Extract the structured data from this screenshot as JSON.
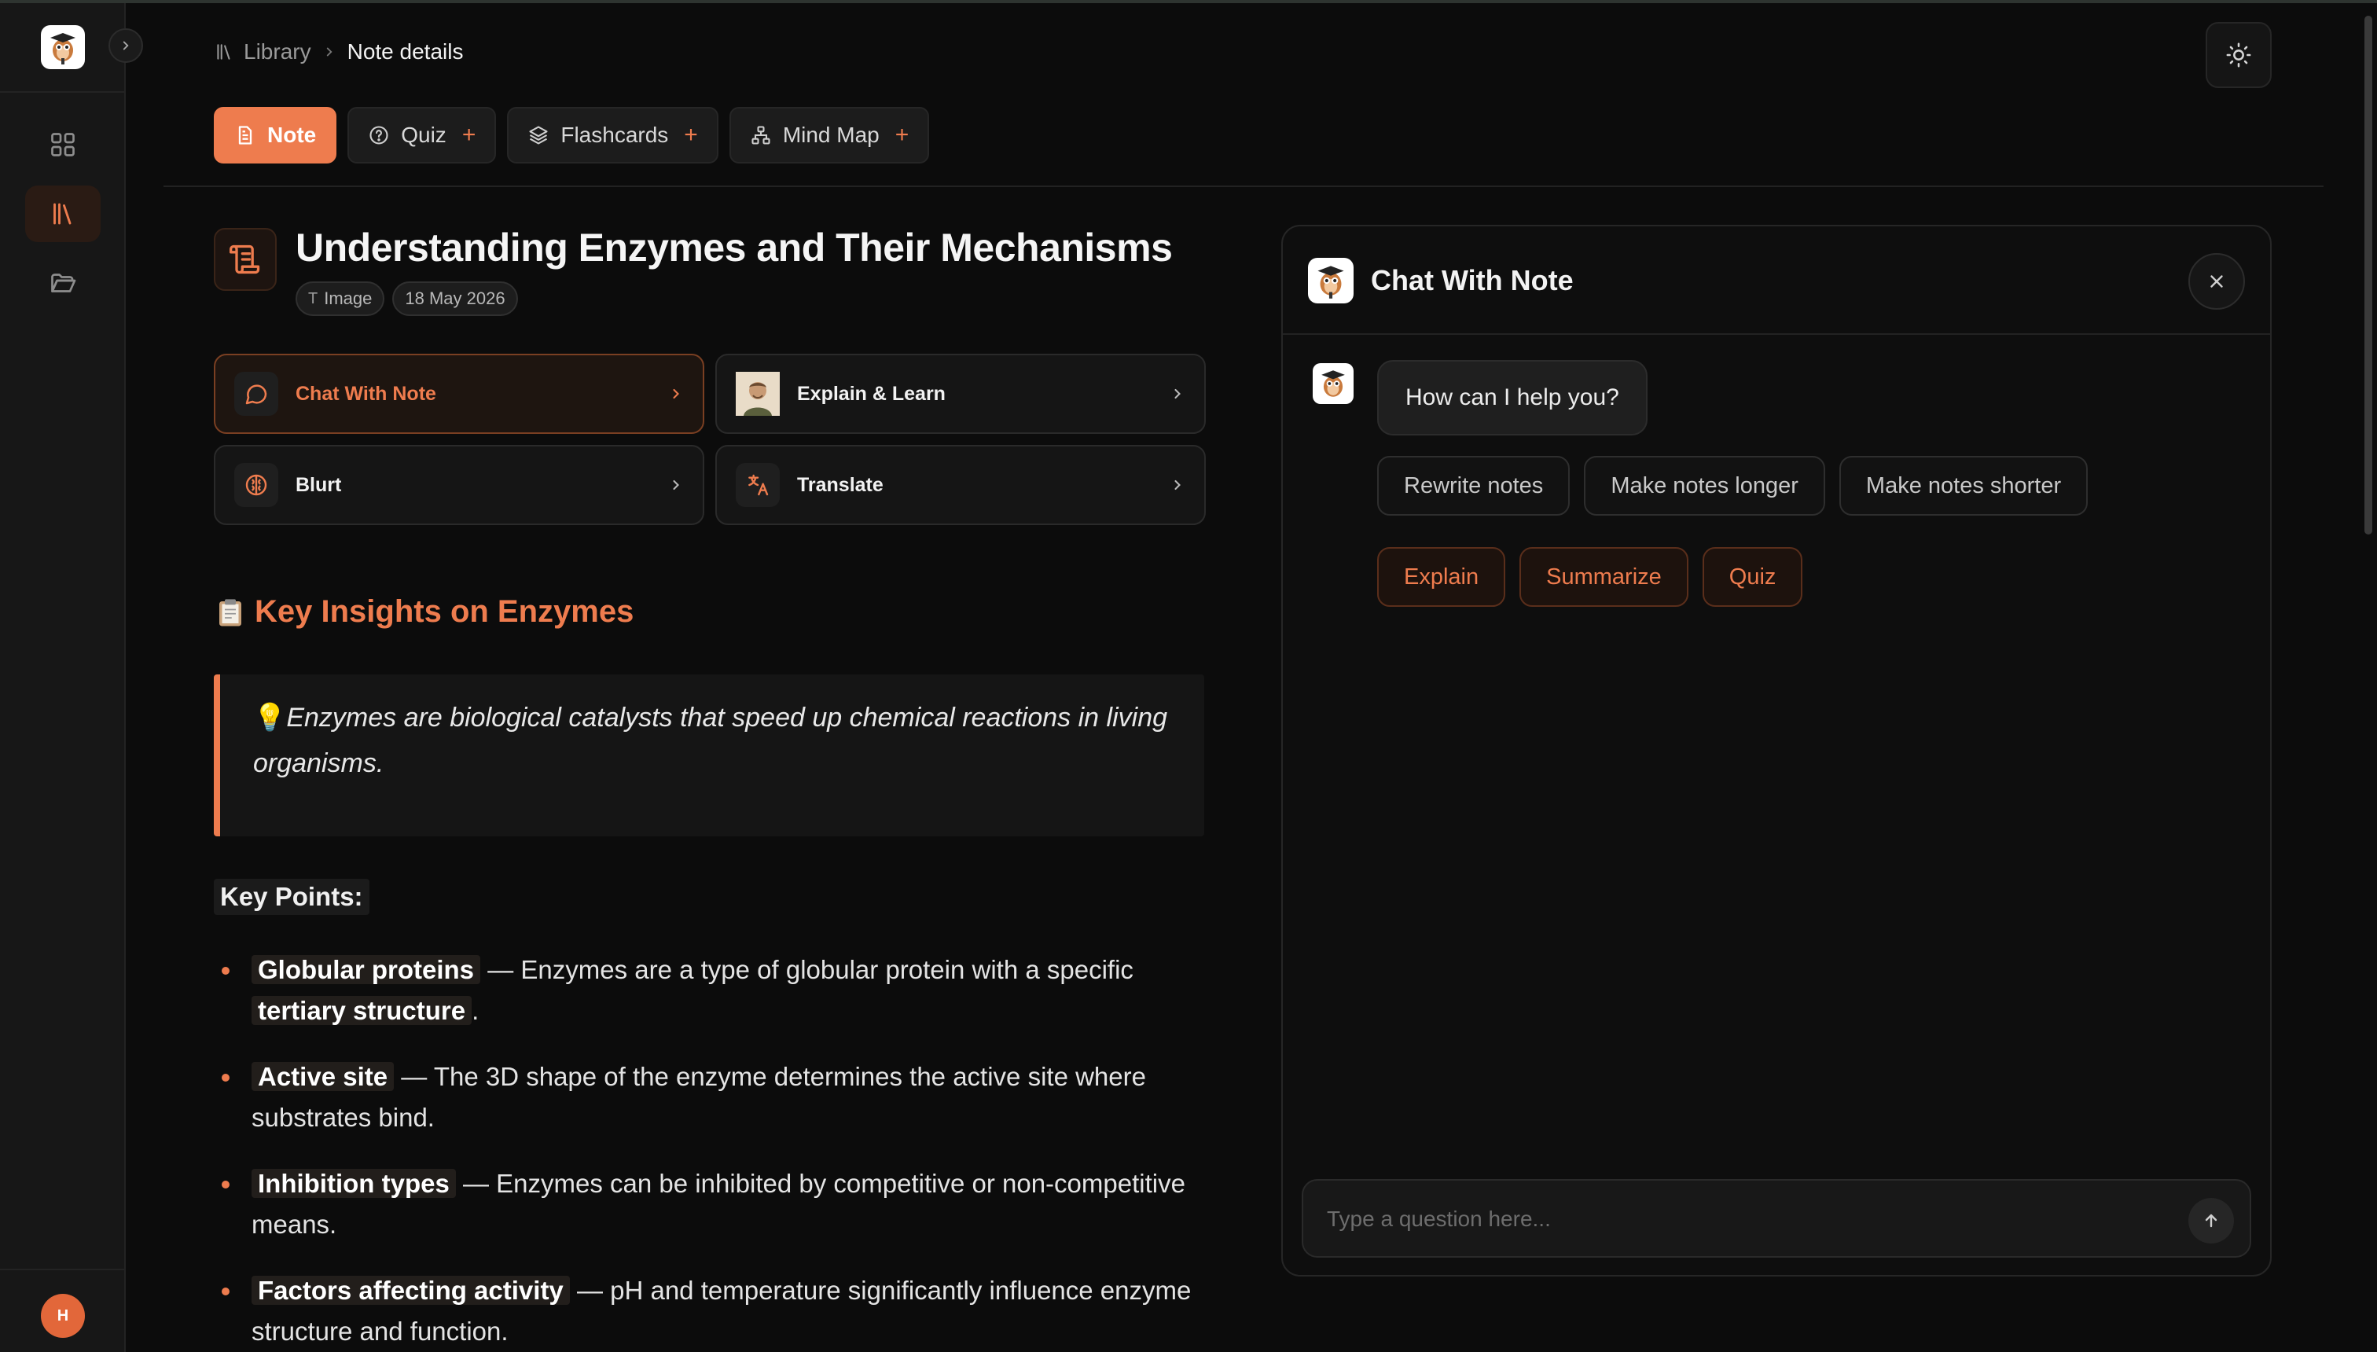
{
  "breadcrumb": {
    "library": "Library",
    "current": "Note details"
  },
  "tabs": [
    {
      "label": "Note",
      "active": true,
      "icon": "document-icon"
    },
    {
      "label": "Quiz",
      "active": false,
      "icon": "help-circle-icon"
    },
    {
      "label": "Flashcards",
      "active": false,
      "icon": "layers-icon"
    },
    {
      "label": "Mind Map",
      "active": false,
      "icon": "sitemap-icon"
    }
  ],
  "note": {
    "title": "Understanding Enzymes and Their Mechanisms",
    "type_chip": "Image",
    "date_chip": "18 May 2026"
  },
  "actions": {
    "chat": "Chat With Note",
    "explain": "Explain & Learn",
    "blurt": "Blurt",
    "translate": "Translate"
  },
  "content": {
    "section_heading": "Key Insights on Enzymes",
    "quote": "Enzymes are biological catalysts that speed up chemical reactions in living organisms.",
    "key_points_label": "Key Points:",
    "bullets": [
      {
        "term": "Globular proteins",
        "text1": " — Enzymes are a type of globular protein with a specific ",
        "term2": "tertiary structure",
        "text2": "."
      },
      {
        "term": "Active site",
        "text1": " — The 3D shape of the enzyme determines the active site where substrates bind."
      },
      {
        "term": "Inhibition types",
        "text1": " — Enzymes can be inhibited by competitive or non-competitive means."
      },
      {
        "term": "Factors affecting activity",
        "text1": " — pH and temperature significantly influence enzyme structure and function."
      }
    ]
  },
  "chat": {
    "title": "Chat With Note",
    "greeting": "How can I help you?",
    "suggestions_row1": [
      "Rewrite notes",
      "Make notes longer",
      "Make notes shorter"
    ],
    "suggestions_row2": [
      "Explain",
      "Summarize",
      "Quiz"
    ],
    "input_placeholder": "Type a question here..."
  },
  "user": {
    "initial": "H"
  },
  "colors": {
    "accent": "#ee7c4e",
    "background": "#0c0c0c",
    "sidebar": "#171717"
  }
}
